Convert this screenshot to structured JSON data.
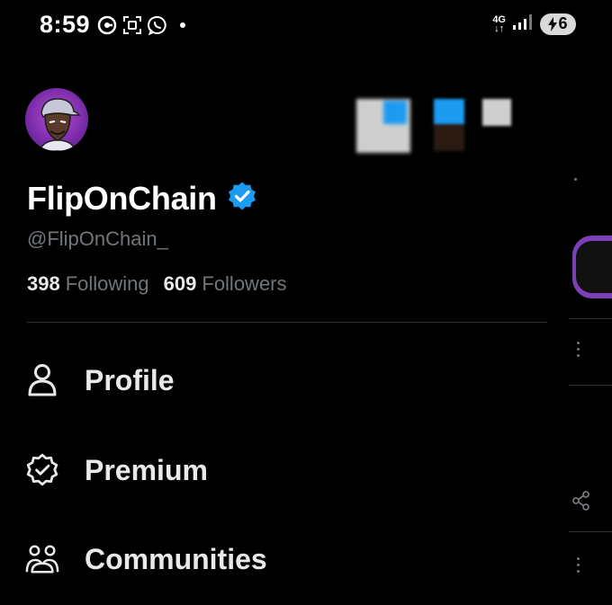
{
  "status_bar": {
    "time": "8:59",
    "network": "4G",
    "battery": "6",
    "left_icons": [
      "g-pay-icon",
      "screenshot-icon",
      "whatsapp-icon",
      "notification-dot"
    ],
    "right_icons": [
      "network-arrows-icon",
      "signal-icon",
      "battery-charging-icon"
    ]
  },
  "profile": {
    "display_name": "FlipOnChain",
    "verified": true,
    "handle": "@FlipOnChain_",
    "following_count": "398",
    "following_label": "Following",
    "followers_count": "609",
    "followers_label": "Followers"
  },
  "menu": {
    "items": [
      {
        "label": "Profile",
        "icon": "person-icon"
      },
      {
        "label": "Premium",
        "icon": "premium-badge-icon"
      },
      {
        "label": "Communities",
        "icon": "communities-icon"
      }
    ]
  },
  "colors": {
    "background": "#000000",
    "text_primary": "#e7e9ea",
    "text_secondary": "#71767b",
    "verified_blue": "#1d9bf0",
    "divider": "#2f3336"
  }
}
